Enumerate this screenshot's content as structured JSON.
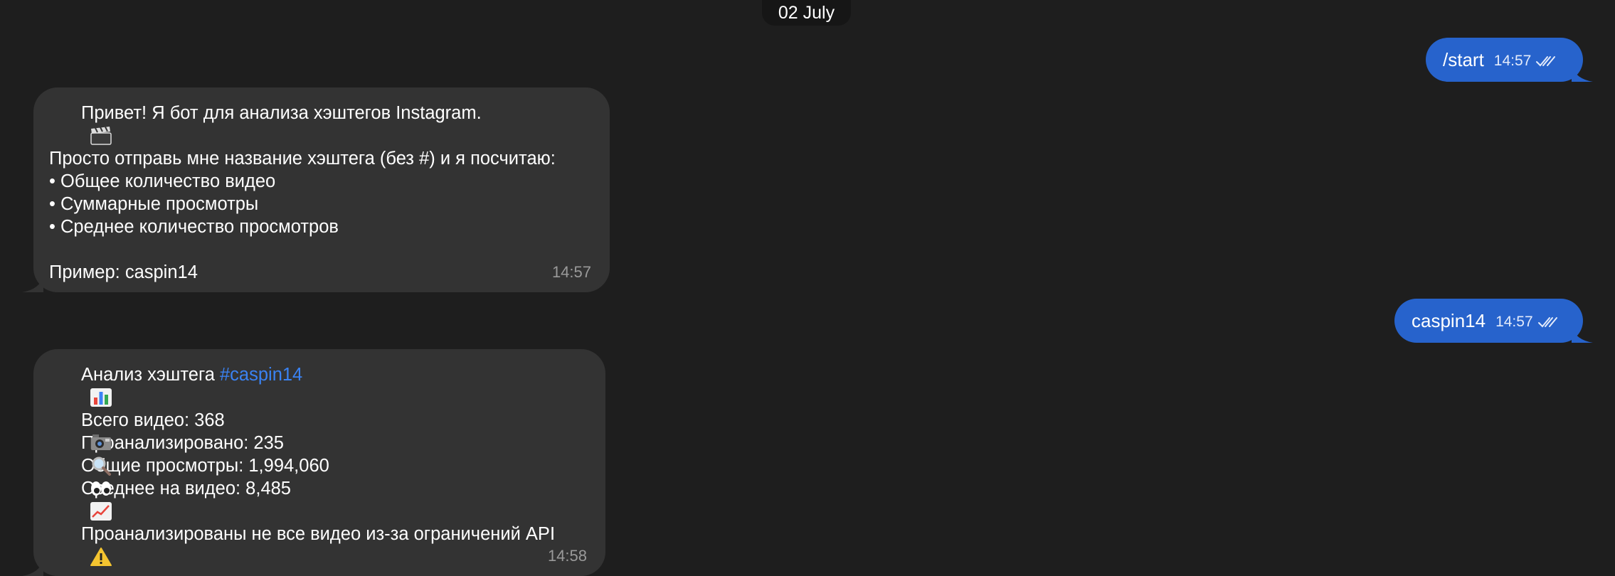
{
  "date_label": "02 July",
  "outgoing": [
    {
      "text": "/start",
      "time": "14:57"
    },
    {
      "text": "caspin14",
      "time": "14:57"
    }
  ],
  "incoming_1": {
    "line1": "Привет! Я бот для анализа хэштегов Instagram.",
    "line2": "Просто отправь мне название хэштега (без #) и я посчитаю:",
    "bullet1": "• Общее количество видео",
    "bullet2": "• Суммарные просмотры",
    "bullet3": "• Среднее количество просмотров",
    "example": "Пример: caspin14",
    "time": "14:57"
  },
  "incoming_2": {
    "title_prefix": "Анализ хэштега ",
    "hashtag": "#caspin14",
    "total_videos": "Всего видео: 368",
    "analyzed": "Проанализировано: 235",
    "total_views": "Общие просмотры: 1,994,060",
    "avg_views": "Среднее на видео: 8,485",
    "warning": "Проанализированы не все видео из-за ограничений API",
    "time": "14:58"
  },
  "icons": {
    "clapper": "clapper-board-icon",
    "chart": "bar-chart-icon",
    "camera": "video-camera-icon",
    "magnifier": "magnifier-icon",
    "eyes": "eyes-icon",
    "trend": "chart-increasing-icon",
    "warning": "warning-icon",
    "ticks": "double-check-icon"
  },
  "colors": {
    "background": "#1e1e1e",
    "outgoing_bubble": "#2763cc",
    "incoming_bubble": "#333333",
    "link": "#3a82f2"
  }
}
